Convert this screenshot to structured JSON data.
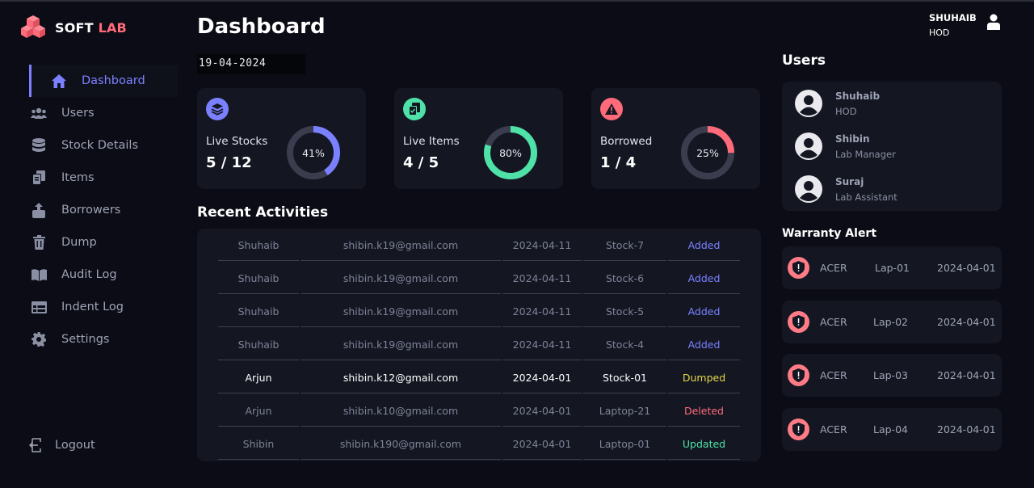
{
  "app": {
    "brand_part1": "SOFT",
    "brand_part2": "LAB",
    "accent": "#7b80ff",
    "danger": "#ff6b7a"
  },
  "sidebar": {
    "items": [
      {
        "label": "Dashboard",
        "icon": "home-icon",
        "active": true
      },
      {
        "label": "Users",
        "icon": "users-icon"
      },
      {
        "label": "Stock Details",
        "icon": "database-icon"
      },
      {
        "label": "Items",
        "icon": "items-icon"
      },
      {
        "label": "Borrowers",
        "icon": "borrow-icon"
      },
      {
        "label": "Dump",
        "icon": "trash-icon"
      },
      {
        "label": "Audit Log",
        "icon": "book-icon"
      },
      {
        "label": "Indent Log",
        "icon": "table-icon"
      },
      {
        "label": "Settings",
        "icon": "gear-icon"
      }
    ],
    "logout_label": "Logout"
  },
  "header": {
    "title": "Dashboard",
    "date": "19-04-2024"
  },
  "profile": {
    "name": "SHUHAIB",
    "role": "HOD"
  },
  "cards": [
    {
      "label": "Live Stocks",
      "value": "5 / 12",
      "percent_label": "41%",
      "percent": 41,
      "color": "#7b80ff",
      "icon": "layers-icon"
    },
    {
      "label": "Live Items",
      "value": "4 / 5",
      "percent_label": "80%",
      "percent": 80,
      "color": "#4ee2a8",
      "icon": "items-box-icon"
    },
    {
      "label": "Borrowed",
      "value": "1 / 4",
      "percent_label": "25%",
      "percent": 25,
      "color": "#ff6b7a",
      "icon": "warning-icon"
    }
  ],
  "recent": {
    "title": "Recent Activities",
    "rows": [
      {
        "name": "Shuhaib",
        "email": "shibin.k19@gmail.com",
        "date": "2024-04-11",
        "item": "Stock-7",
        "status": "Added"
      },
      {
        "name": "Shuhaib",
        "email": "shibin.k19@gmail.com",
        "date": "2024-04-11",
        "item": "Stock-6",
        "status": "Added"
      },
      {
        "name": "Shuhaib",
        "email": "shibin.k19@gmail.com",
        "date": "2024-04-11",
        "item": "Stock-5",
        "status": "Added"
      },
      {
        "name": "Shuhaib",
        "email": "shibin.k19@gmail.com",
        "date": "2024-04-11",
        "item": "Stock-4",
        "status": "Added"
      },
      {
        "name": "Arjun",
        "email": "shibin.k12@gmail.com",
        "date": "2024-04-01",
        "item": "Stock-01",
        "status": "Dumped"
      },
      {
        "name": "Arjun",
        "email": "shibin.k10@gmail.com",
        "date": "2024-04-01",
        "item": "Laptop-21",
        "status": "Deleted"
      },
      {
        "name": "Shibin",
        "email": "shibin.k190@gmail.com",
        "date": "2024-04-01",
        "item": "Laptop-01",
        "status": "Updated"
      }
    ]
  },
  "users": {
    "title": "Users",
    "list": [
      {
        "name": "Shuhaib",
        "role": "HOD"
      },
      {
        "name": "Shibin",
        "role": "Lab Manager"
      },
      {
        "name": "Suraj",
        "role": "Lab Assistant"
      }
    ]
  },
  "warranty": {
    "title": "Warranty Alert",
    "list": [
      {
        "brand": "ACER",
        "item": "Lap-01",
        "date": "2024-04-01"
      },
      {
        "brand": "ACER",
        "item": "Lap-02",
        "date": "2024-04-01"
      },
      {
        "brand": "ACER",
        "item": "Lap-03",
        "date": "2024-04-01"
      },
      {
        "brand": "ACER",
        "item": "Lap-04",
        "date": "2024-04-01"
      }
    ]
  }
}
